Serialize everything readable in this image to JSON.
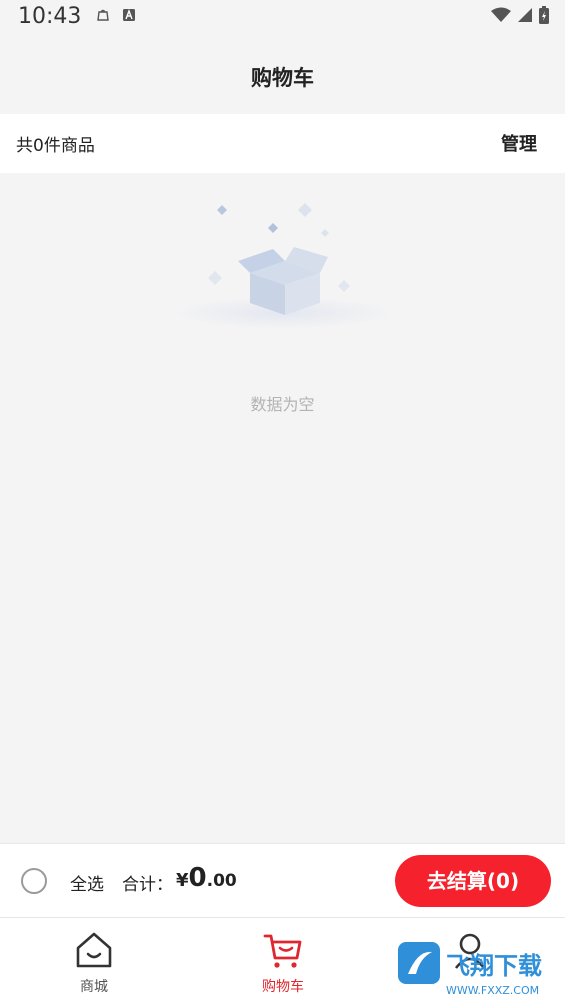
{
  "status_bar": {
    "time": "10:43"
  },
  "header": {
    "title": "购物车"
  },
  "summary": {
    "count_text": "共0件商品",
    "manage_label": "管理"
  },
  "empty_state": {
    "message": "数据为空"
  },
  "checkout": {
    "select_all_label": "全选",
    "total_label": "合计：",
    "currency_symbol": "¥",
    "total_integer": "0",
    "total_decimal": ".00",
    "button_label": "去结算(0)"
  },
  "tabs": [
    {
      "label": "商城",
      "icon": "home-icon",
      "active": false
    },
    {
      "label": "购物车",
      "icon": "cart-icon",
      "active": true
    },
    {
      "label": "",
      "icon": "profile-icon",
      "active": false
    }
  ],
  "watermark": {
    "brand": "飞翔下载",
    "url": "WWW.FXXZ.COM"
  },
  "colors": {
    "accent": "#f5222d",
    "active_tab": "#e0272f",
    "background": "#f4f4f4"
  }
}
